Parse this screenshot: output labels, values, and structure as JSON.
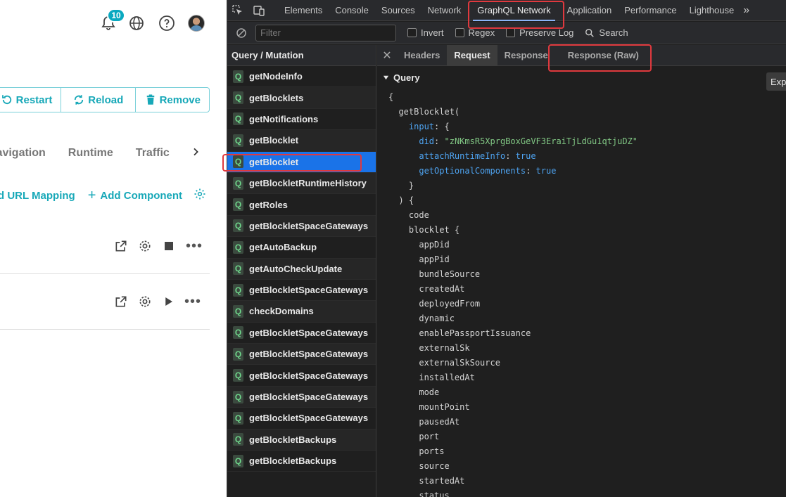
{
  "app": {
    "notification_count": "10",
    "actions": [
      "Restart",
      "Reload",
      "Remove"
    ],
    "tabs": [
      "Navigation",
      "Runtime",
      "Traffic"
    ],
    "links": [
      "Add URL Mapping",
      "Add Component"
    ],
    "accent": "#17a8b8"
  },
  "devtools": {
    "tabs": [
      "Elements",
      "Console",
      "Sources",
      "Network",
      "GraphQL Network",
      "Application",
      "Performance",
      "Lighthouse"
    ],
    "active_tab": "GraphQL Network",
    "more_label": "»",
    "filter": {
      "placeholder": "Filter",
      "invert_label": "Invert",
      "regex_label": "Regex",
      "preserve_log_label": "Preserve Log",
      "search_label": "Search"
    },
    "list_header": "Query / Mutation",
    "query_tag": "Q",
    "queries": [
      "getNodeInfo",
      "getBlocklets",
      "getNotifications",
      "getBlocklet",
      "getBlocklet",
      "getBlockletRuntimeHistory",
      "getRoles",
      "getBlockletSpaceGateways",
      "getAutoBackup",
      "getAutoCheckUpdate",
      "getBlockletSpaceGateways",
      "checkDomains",
      "getBlockletSpaceGateways",
      "getBlockletSpaceGateways",
      "getBlockletSpaceGateways",
      "getBlockletSpaceGateways",
      "getBlockletSpaceGateways",
      "getBlockletBackups",
      "getBlockletBackups"
    ],
    "selected_query_index": 4,
    "detail_tabs": [
      "Headers",
      "Request",
      "Response",
      "Response (Raw)"
    ],
    "active_detail_tab": "Request",
    "close_label": "✕",
    "query_section_label": "Query",
    "export_label": "Export",
    "code": {
      "open_brace": "{",
      "func": "getBlocklet(",
      "input_key": "input",
      "did_key": "did",
      "did_value": "\"zNKmsR5XprgBoxGeVF3EraiTjLdGu1qtjuDZ\"",
      "attach_key": "attachRuntimeInfo",
      "attach_value": "true",
      "optional_key": "getOptionalComponents",
      "optional_value": "true",
      "code_field": "code",
      "blocklet_field": "blocklet",
      "fields": [
        "appDid",
        "appPid",
        "bundleSource",
        "createdAt",
        "deployedFrom",
        "dynamic",
        "enablePassportIssuance",
        "externalSk",
        "externalSkSource",
        "installedAt",
        "mode",
        "mountPoint",
        "pausedAt",
        "port",
        "ports",
        "source",
        "startedAt",
        "status"
      ]
    }
  }
}
